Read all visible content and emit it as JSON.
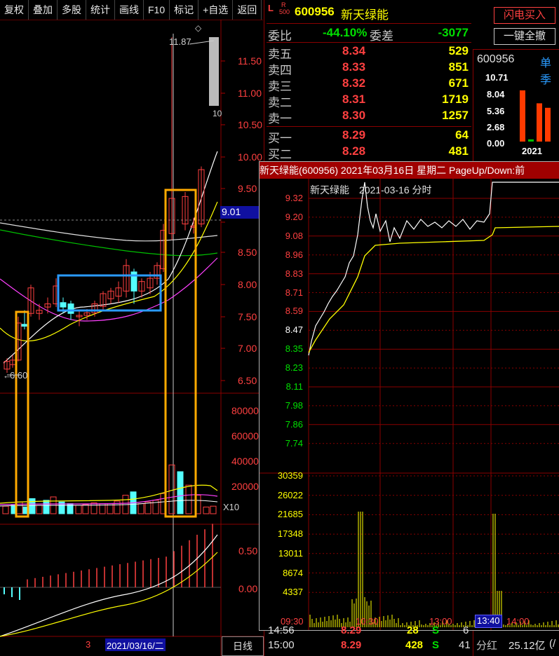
{
  "toolbar": {
    "buttons": [
      "复权",
      "叠加",
      "多股",
      "统计",
      "画线",
      "F10",
      "标记",
      "+自选",
      "返回"
    ]
  },
  "quote": {
    "market_tag": "L",
    "tag_r": "R",
    "tag_500": "500",
    "code": "600956",
    "name": "新天绿能",
    "weibi_label": "委比",
    "weibi_value": "-44.10%",
    "weicha_label": "委差",
    "weicha_value": "-3077",
    "sell": [
      {
        "label": "卖五",
        "price": "8.34",
        "vol": "529"
      },
      {
        "label": "卖四",
        "price": "8.33",
        "vol": "851"
      },
      {
        "label": "卖三",
        "price": "8.32",
        "vol": "671"
      },
      {
        "label": "卖二",
        "price": "8.31",
        "vol": "1719"
      },
      {
        "label": "卖一",
        "price": "8.30",
        "vol": "1257"
      }
    ],
    "buy": [
      {
        "label": "买一",
        "price": "8.29",
        "vol": "64"
      },
      {
        "label": "买二",
        "price": "8.28",
        "vol": "481"
      }
    ],
    "flash_buy": "闪电买入",
    "one_key_cancel": "一键全撤",
    "mini_code": "600956",
    "mini_tab": "单季",
    "mini_y": [
      "10.71",
      "8.04",
      "5.36",
      "2.68",
      "0.00"
    ],
    "mini_year": "2021",
    "mini_bars": [
      {
        "value": 9.1,
        "color": "#ff3a00"
      },
      {
        "value": 0.4,
        "color": "#00c000"
      },
      {
        "value": 6.8,
        "color": "#ff3a00"
      },
      {
        "value": 6.0,
        "color": "#ff3a00"
      }
    ]
  },
  "kline": {
    "price_labels": [
      "11.50",
      "11.00",
      "10.50",
      "10.00",
      "9.50",
      "9.01",
      "8.50",
      "8.00",
      "7.50",
      "7.00",
      "6.50"
    ],
    "high_label": "11.87",
    "high_tail": "10",
    "low_label": "6.60",
    "vol_labels": [
      "80000",
      "60000",
      "40000",
      "20000"
    ],
    "vol_unit": "X10",
    "macd_labels": [
      "0.50",
      "0.00"
    ],
    "date_label": "2021/03/16/二",
    "date_prefix": "3",
    "period": "日线"
  },
  "popup": {
    "title": "新天绿能(600956) 2021年03月16日 星期二 PageUp/Down:前",
    "chart_name": "新天绿能",
    "chart_date": "2021-03-16 分时",
    "price_labels": [
      "9.32",
      "9.20",
      "9.08",
      "8.96",
      "8.83",
      "8.71",
      "8.59",
      "8.47",
      "8.35",
      "8.23",
      "8.11",
      "7.98",
      "7.86",
      "7.74"
    ],
    "vol_labels": [
      "30359",
      "26022",
      "21685",
      "17348",
      "13011",
      "8674",
      "4337"
    ],
    "time_labels": [
      "09:30",
      "10:30",
      "13:00",
      "13:40",
      "14:00"
    ],
    "cursor_time": "13:40"
  },
  "bottom": {
    "row1_time": "14:56",
    "row1_price": "8.29",
    "row1_vol": "28",
    "row1_flag": "S",
    "row1_n": "6",
    "row2_time": "15:00",
    "row2_price": "8.29",
    "row2_vol": "428",
    "row2_flag": "S",
    "row2_n": "41",
    "dividend_label": "分红",
    "dividend_value": "25.12亿",
    "dividend_suffix": "(/"
  },
  "colors": {
    "up": "#ff4040",
    "down": "#54ffff",
    "highlight_orange": "#ffaa00",
    "highlight_blue": "#2a9bff",
    "price_line": "#ffffff",
    "avg_line": "#ffff00"
  }
}
